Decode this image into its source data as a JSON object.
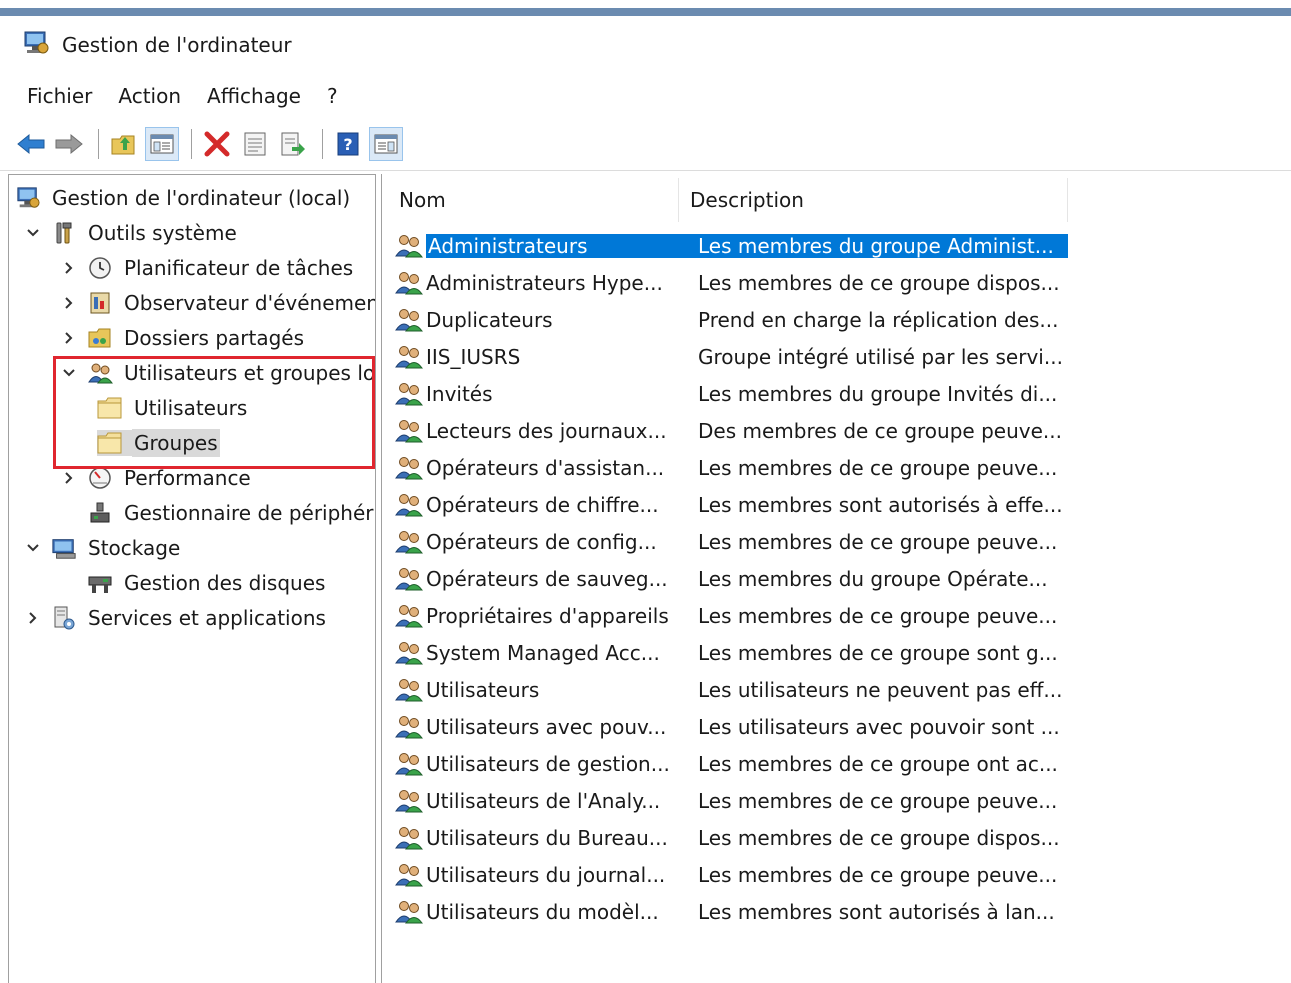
{
  "window": {
    "title": "Gestion de l'ordinateur"
  },
  "menu": [
    "Fichier",
    "Action",
    "Affichage",
    "?"
  ],
  "tree": [
    {
      "label": "Gestion de l'ordinateur (local)",
      "level": 0,
      "chevron": "",
      "icon": "computer-management-icon"
    },
    {
      "label": "Outils système",
      "level": 1,
      "chevron": "down",
      "icon": "tools-icon"
    },
    {
      "label": "Planificateur de tâches",
      "level": 2,
      "chevron": "right",
      "icon": "clock-icon"
    },
    {
      "label": "Observateur d'événements",
      "level": 2,
      "chevron": "right",
      "icon": "event-viewer-icon"
    },
    {
      "label": "Dossiers partagés",
      "level": 2,
      "chevron": "right",
      "icon": "shared-folder-icon"
    },
    {
      "label": "Utilisateurs et groupes locaux",
      "level": 2,
      "chevron": "down",
      "icon": "users-icon"
    },
    {
      "label": "Utilisateurs",
      "level": 3,
      "chevron": "",
      "icon": "folder-icon"
    },
    {
      "label": "Groupes",
      "level": 3,
      "chevron": "",
      "icon": "folder-icon",
      "selected": true
    },
    {
      "label": "Performance",
      "level": 2,
      "chevron": "right",
      "icon": "performance-icon"
    },
    {
      "label": "Gestionnaire de périphériques",
      "level": 2,
      "chevron": "",
      "icon": "device-manager-icon"
    },
    {
      "label": "Stockage",
      "level": 1,
      "chevron": "down",
      "icon": "storage-icon"
    },
    {
      "label": "Gestion des disques",
      "level": 2,
      "chevron": "",
      "icon": "disk-icon"
    },
    {
      "label": "Services et applications",
      "level": 1,
      "chevron": "right",
      "icon": "services-icon"
    }
  ],
  "list": {
    "columns": [
      "Nom",
      "Description"
    ],
    "rows": [
      {
        "name": "Administrateurs",
        "desc": "Les membres du groupe Administ...",
        "selected": true
      },
      {
        "name": "Administrateurs Hype...",
        "desc": "Les membres de ce groupe dispos..."
      },
      {
        "name": "Duplicateurs",
        "desc": "Prend en charge la réplication des..."
      },
      {
        "name": "IIS_IUSRS",
        "desc": "Groupe intégré utilisé par les servi..."
      },
      {
        "name": "Invités",
        "desc": "Les membres du groupe Invités di..."
      },
      {
        "name": "Lecteurs des journaux...",
        "desc": "Des membres de ce groupe peuve..."
      },
      {
        "name": "Opérateurs d'assistan...",
        "desc": "Les membres de ce groupe peuve..."
      },
      {
        "name": "Opérateurs de chiffre...",
        "desc": "Les membres sont autorisés à effe..."
      },
      {
        "name": "Opérateurs de config...",
        "desc": "Les membres de ce groupe peuve..."
      },
      {
        "name": "Opérateurs de sauveg...",
        "desc": "Les membres du groupe Opérate..."
      },
      {
        "name": "Propriétaires d'appareils",
        "desc": "Les membres de ce groupe peuve..."
      },
      {
        "name": "System Managed Acc...",
        "desc": "Les membres de ce groupe sont g..."
      },
      {
        "name": "Utilisateurs",
        "desc": "Les utilisateurs ne peuvent pas eff..."
      },
      {
        "name": "Utilisateurs avec pouv...",
        "desc": "Les utilisateurs avec pouvoir sont ..."
      },
      {
        "name": "Utilisateurs de gestion...",
        "desc": "Les membres de ce groupe ont ac..."
      },
      {
        "name": "Utilisateurs de l'Analy...",
        "desc": "Les membres de ce groupe peuve..."
      },
      {
        "name": "Utilisateurs du Bureau...",
        "desc": "Les membres de ce groupe dispos..."
      },
      {
        "name": "Utilisateurs du journal...",
        "desc": "Les membres de ce groupe peuve..."
      },
      {
        "name": "Utilisateurs du modèl...",
        "desc": "Les membres sont autorisés à lan..."
      }
    ]
  },
  "colors": {
    "selection": "#0078d7",
    "highlight_box": "#e0262f",
    "accent_strip": "#6b8bb0"
  }
}
